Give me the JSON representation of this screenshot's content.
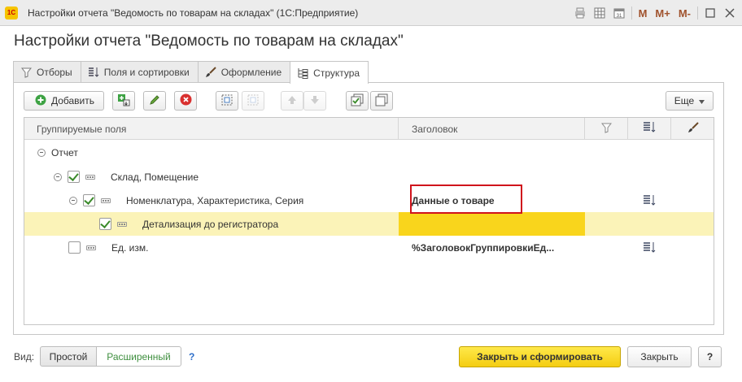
{
  "window": {
    "title": "Настройки отчета \"Ведомость по товарам на складах\"  (1С:Предприятие)",
    "logo": "1С",
    "buttons": [
      "M",
      "M+",
      "M-"
    ]
  },
  "page": {
    "title": "Настройки отчета \"Ведомость по товарам на складах\""
  },
  "tabs": [
    {
      "label": "Отборы",
      "icon": "funnel-icon"
    },
    {
      "label": "Поля и сортировки",
      "icon": "fields-sort-icon"
    },
    {
      "label": "Оформление",
      "icon": "brush-icon"
    },
    {
      "label": "Структура",
      "icon": "structure-icon",
      "active": true
    }
  ],
  "toolbar": {
    "add_label": "Добавить",
    "more_label": "Еще"
  },
  "grid": {
    "columns": [
      "Группируемые поля",
      "Заголовок"
    ],
    "rows": [
      {
        "label": "Отчет",
        "level": 0,
        "checkbox": null,
        "title": "",
        "sort": false
      },
      {
        "label": "Склад, Помещение",
        "level": 1,
        "checkbox": true,
        "title": "",
        "sort": false
      },
      {
        "label": "Номенклатура, Характеристика, Серия",
        "level": 2,
        "checkbox": true,
        "title": "Данные о товаре",
        "sort": true
      },
      {
        "label": "Детализация до регистратора",
        "level": 3,
        "checkbox": true,
        "title": "",
        "sort": false,
        "selected": true
      },
      {
        "label": "Ед. изм.",
        "level": 1,
        "checkbox": false,
        "title": "%ЗаголовокГруппировкиЕд...",
        "sort": true
      }
    ]
  },
  "footer": {
    "view_label": "Вид:",
    "simple": "Простой",
    "advanced": "Расширенный",
    "help_q": "?",
    "close_generate": "Закрыть и сформировать",
    "close": "Закрыть",
    "help": "?"
  },
  "colors": {
    "accent_yellow": "#f4cd12",
    "row_highlight": "#fbf3b8",
    "highlight_box": "#d0141c",
    "advanced_text": "#3f8f3f"
  }
}
